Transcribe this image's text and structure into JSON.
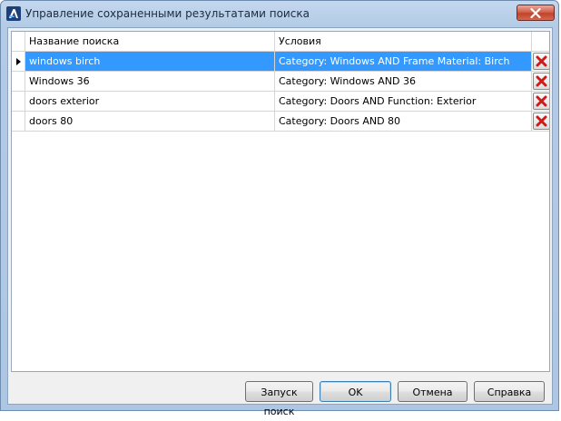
{
  "window": {
    "title": "Управление сохраненными результатами поиска"
  },
  "grid": {
    "columns": [
      "Название поиска",
      "Условия"
    ],
    "rows": [
      {
        "name": "windows birch",
        "conditions": "Category: Windows AND Frame Material: Birch",
        "selected": true
      },
      {
        "name": "Windows 36",
        "conditions": "Category: Windows AND 36",
        "selected": false
      },
      {
        "name": "doors exterior",
        "conditions": "Category: Doors AND Function: Exterior",
        "selected": false
      },
      {
        "name": "doors 80",
        "conditions": "Category: Doors AND 80",
        "selected": false
      }
    ],
    "delete_icon": "red-x-icon"
  },
  "buttons": {
    "run": "Запуск поиск",
    "ok": "OK",
    "cancel": "Отмена",
    "help": "Справка"
  },
  "colors": {
    "selection": "#3399ff",
    "delete_x": "#cc1b1b",
    "title_bar": "#b4cbe6"
  }
}
